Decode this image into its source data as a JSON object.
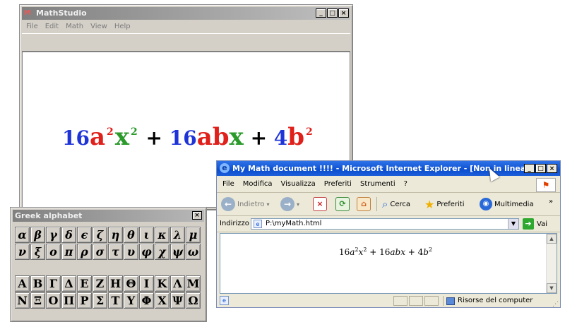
{
  "mathstudio": {
    "title": "MathStudio",
    "menu": [
      "File",
      "Edit",
      "Math",
      "View",
      "Help"
    ],
    "formula": {
      "coef1": "16",
      "a": "a",
      "a_exp": "2",
      "x": "x",
      "x_exp": "2",
      "plus1": "+",
      "coef2": "16",
      "a2": "a",
      "b": "b",
      "x2": "x",
      "plus2": "+",
      "coef3": "4",
      "b2": "b",
      "b_exp": "2"
    }
  },
  "greek": {
    "title": "Greek alphabet",
    "lower": [
      "α",
      "β",
      "γ",
      "δ",
      "ϵ",
      "ζ",
      "η",
      "θ",
      "ι",
      "κ",
      "λ",
      "μ",
      "ν",
      "ξ",
      "ο",
      "π",
      "ρ",
      "σ",
      "τ",
      "υ",
      "φ",
      "χ",
      "ψ",
      "ω"
    ],
    "upper": [
      "A",
      "B",
      "Γ",
      "Δ",
      "E",
      "Z",
      "H",
      "Θ",
      "I",
      "K",
      "Λ",
      "M",
      "N",
      "Ξ",
      "O",
      "Π",
      "P",
      "Σ",
      "T",
      "Υ",
      "Φ",
      "X",
      "Ψ",
      "Ω"
    ]
  },
  "ie": {
    "title": "My Math document !!!! - Microsoft Internet Explorer - [Non in linea]",
    "menu": [
      "File",
      "Modifica",
      "Visualizza",
      "Preferiti",
      "Strumenti",
      "?"
    ],
    "toolbar": {
      "back": "Indietro",
      "search": "Cerca",
      "favorites": "Preferiti",
      "media": "Multimedia",
      "more": "»"
    },
    "address": {
      "label": "Indirizzo",
      "value": "P:\\myMath.html",
      "go": "Vai"
    },
    "content": {
      "c1": "16",
      "a": "a",
      "e1": "2",
      "x": "x",
      "e2": "2",
      "p1": " + 16",
      "abx": "abx",
      "p2": " + 4",
      "b": "b",
      "e3": "2"
    },
    "status": {
      "zone": "Risorse del computer"
    }
  }
}
